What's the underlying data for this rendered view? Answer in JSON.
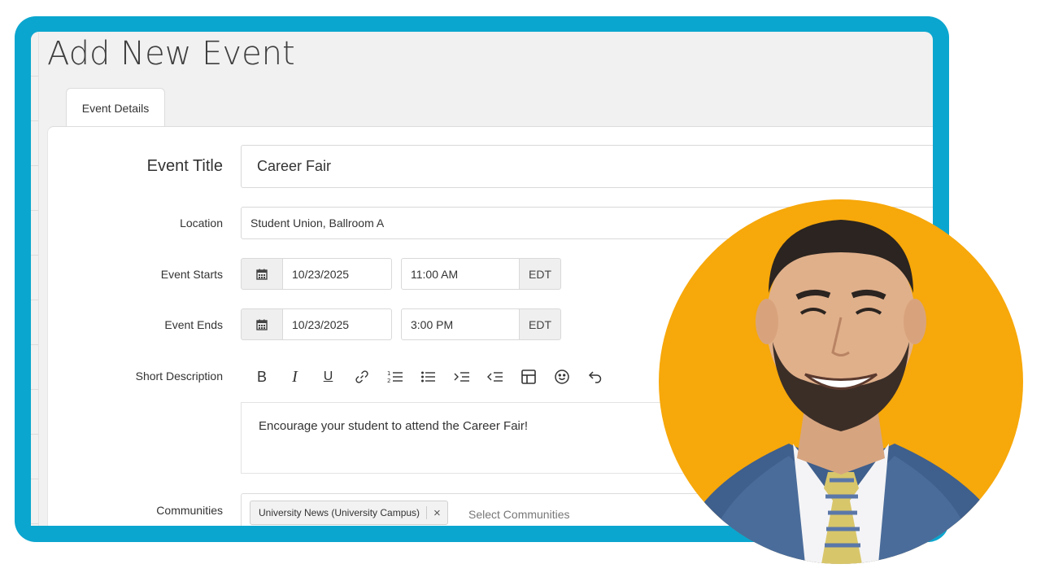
{
  "page": {
    "title": "Add New Event"
  },
  "tabs": [
    {
      "label": "Event Details"
    }
  ],
  "form": {
    "event_title": {
      "label": "Event Title",
      "value": "Career Fair"
    },
    "location": {
      "label": "Location",
      "value": "Student Union, Ballroom A"
    },
    "event_starts": {
      "label": "Event Starts",
      "date": "10/23/2025",
      "time": "11:00 AM",
      "tz": "EDT"
    },
    "event_ends": {
      "label": "Event Ends",
      "date": "10/23/2025",
      "time": "3:00 PM",
      "tz": "EDT"
    },
    "short_description": {
      "label": "Short Description",
      "value": "Encourage your student to attend the Career Fair!",
      "toolbar": [
        "bold",
        "italic",
        "underline",
        "link",
        "numbered-list",
        "bulleted-list",
        "indent",
        "outdent",
        "table",
        "emoji",
        "undo"
      ]
    },
    "communities": {
      "label": "Communities",
      "selected": [
        "University News (University Campus)"
      ],
      "remove_glyph": "×",
      "placeholder": "Select Communities"
    }
  },
  "colors": {
    "frame": "#0ba6cf",
    "avatar_background": "#f7a80a",
    "panel": "#ffffff",
    "window": "#f1f1f1"
  }
}
